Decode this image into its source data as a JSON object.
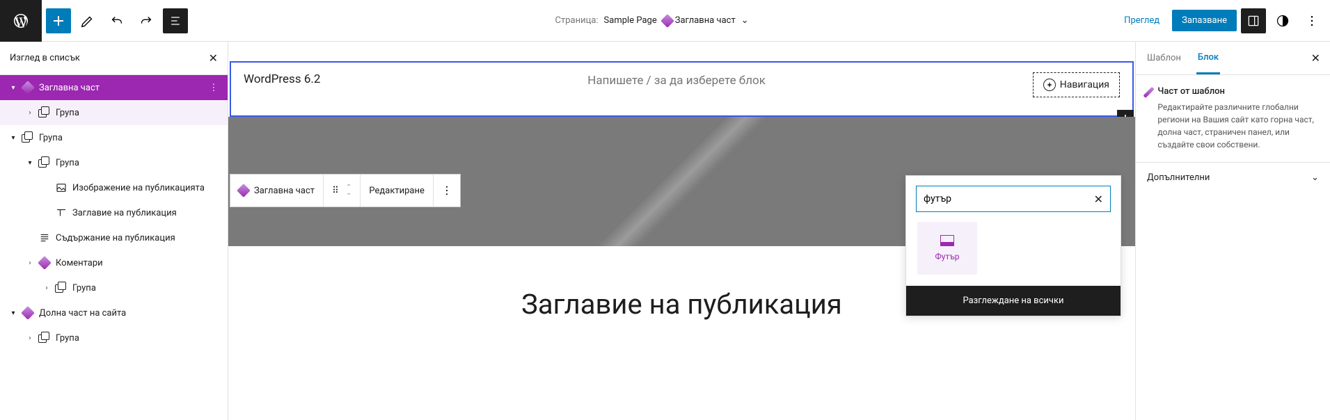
{
  "top": {
    "page_prefix": "Страница:",
    "page_name": "Sample Page",
    "active_part": "Заглавна част",
    "preview": "Преглед",
    "save": "Запазване"
  },
  "list_panel": {
    "title": "Изглед в списък",
    "items": [
      {
        "indent": 0,
        "chev": "▾",
        "icon": "diamond",
        "label": "Заглавна част",
        "hl": "hl",
        "dots": true
      },
      {
        "indent": 1,
        "chev": "›",
        "icon": "group",
        "label": "Група",
        "hl": "hl2"
      },
      {
        "indent": 0,
        "chev": "▾",
        "icon": "group",
        "label": "Група"
      },
      {
        "indent": 1,
        "chev": "▾",
        "icon": "group",
        "label": "Група"
      },
      {
        "indent": 2,
        "chev": "",
        "icon": "featimg",
        "label": "Изображение на публикацията"
      },
      {
        "indent": 2,
        "chev": "",
        "icon": "title",
        "label": "Заглавие на публикация"
      },
      {
        "indent": 1,
        "chev": "",
        "icon": "content",
        "label": "Съдържание на публикация"
      },
      {
        "indent": 1,
        "chev": "›",
        "icon": "diamond",
        "label": "Коментари"
      },
      {
        "indent": 2,
        "chev": "›",
        "icon": "group",
        "label": "Група"
      },
      {
        "indent": 0,
        "chev": "▾",
        "icon": "diamond",
        "label": "Долна част на сайта"
      },
      {
        "indent": 1,
        "chev": "›",
        "icon": "group",
        "label": "Група"
      }
    ]
  },
  "canvas": {
    "site_title": "WordPress 6.2",
    "placeholder": "Напишете / за да изберете блок",
    "nav": "Навигация",
    "post_title": "Заглавие на публикация"
  },
  "toolbar": {
    "block_label": "Заглавна част",
    "edit": "Редактиране"
  },
  "search": {
    "value": "футър",
    "result_label": "Футър",
    "browse_all": "Разглеждане на всички"
  },
  "sidebar": {
    "tab_template": "Шаблон",
    "tab_block": "Блок",
    "block_title": "Част от шаблон",
    "block_desc": "Редактирайте различните глобални региони на Вашия сайт като горна част, долна част, страничен панел, или създайте свои собствени.",
    "advanced": "Допълнителни"
  }
}
